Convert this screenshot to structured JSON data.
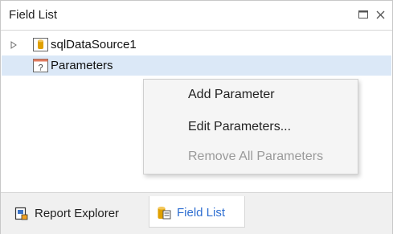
{
  "panel": {
    "title": "Field List",
    "title_buttons": [
      "maximize-icon",
      "close-icon"
    ]
  },
  "tree": {
    "items": [
      {
        "label": "sqlDataSource1",
        "icon": "database-icon",
        "expander": "collapsed"
      },
      {
        "label": "Parameters",
        "icon": "parameters-icon",
        "selected": true
      }
    ]
  },
  "context_menu": {
    "items": [
      {
        "label": "Add Parameter",
        "enabled": true
      },
      {
        "label": "Edit Parameters...",
        "enabled": true
      },
      {
        "label": "Remove All Parameters",
        "enabled": false
      }
    ]
  },
  "bottom_tabs": [
    {
      "label": "Report Explorer",
      "icon": "report-explorer-icon",
      "active": false
    },
    {
      "label": "Field List",
      "icon": "field-list-icon",
      "active": true
    }
  ],
  "colors": {
    "selection": "#dbe8f7",
    "active_tab_text": "#2f6fd1",
    "disabled_text": "#9a9a9a",
    "icon_accent": "#e0a000"
  }
}
